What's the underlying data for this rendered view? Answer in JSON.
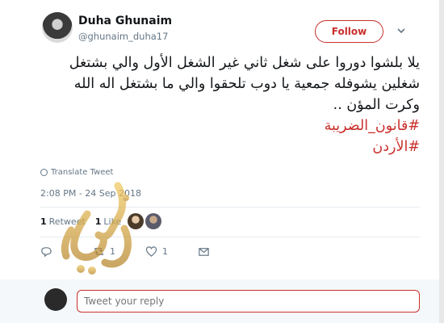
{
  "user": {
    "display_name": "Duha Ghunaim",
    "handle": "@ghunaim_duha17",
    "avatar_icon": "profile-photo"
  },
  "follow_button": {
    "label": "Follow",
    "color": "#c9302c"
  },
  "menu_icon": "chevron-down-icon",
  "tweet": {
    "lines": [
      "يلا بلشوا دوروا على شغل ثاني غير الشغل الأول والي بشتغل",
      "شغلين يشوفله جمعية يا دوب تلحقوا والي ما بشتغل اله الله",
      "وكرت المؤن .."
    ],
    "hashtags": [
      "#قانون_الضريبة",
      "#الأردن"
    ],
    "hashtag_color": "#c9302c"
  },
  "translate_label": "Translate Tweet",
  "timestamp": "2:08 PM - 24 Sep 2018",
  "stats": {
    "retweets_count": "1",
    "retweets_label": "Retweet",
    "likes_count": "1",
    "likes_label": "Like"
  },
  "actions": {
    "reply_count": "",
    "retweet_count": "1",
    "like_count": "1"
  },
  "reply": {
    "placeholder": "Tweet your reply"
  },
  "watermark": "الوكيل"
}
